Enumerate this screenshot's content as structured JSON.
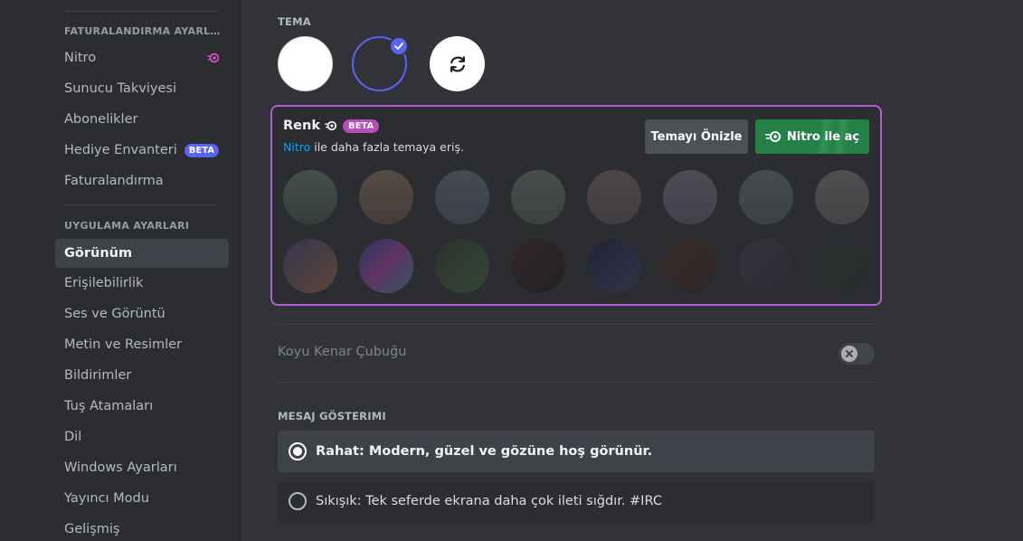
{
  "sidebar": {
    "billing_header": "FATURALANDIRMA AYARLA...",
    "billing_items": [
      {
        "label": "Nitro"
      },
      {
        "label": "Sunucu Takviyesi"
      },
      {
        "label": "Abonelikler"
      },
      {
        "label": "Hediye Envanteri",
        "badge": "BETA"
      },
      {
        "label": "Faturalandırma"
      }
    ],
    "app_header": "UYGULAMA AYARLARI",
    "app_items": [
      {
        "label": "Görünüm",
        "active": true
      },
      {
        "label": "Erişilebilirlik"
      },
      {
        "label": "Ses ve Görüntü"
      },
      {
        "label": "Metin ve Resimler"
      },
      {
        "label": "Bildirimler"
      },
      {
        "label": "Tuş Atamaları"
      },
      {
        "label": "Dil"
      },
      {
        "label": "Windows Ayarları"
      },
      {
        "label": "Yayıncı Modu"
      },
      {
        "label": "Gelişmiş"
      }
    ]
  },
  "theme": {
    "label": "TEMA",
    "selected": "dark",
    "color": {
      "title": "Renk",
      "badge": "BETA",
      "subtitle_link": "Nitro",
      "subtitle_rest": " ile daha fazla temaya eriş.",
      "preview_button": "Temayı Önizle",
      "nitro_button": "Nitro ile aç"
    }
  },
  "dark_sidebar": {
    "label": "Koyu Kenar Çubuğu",
    "enabled": false
  },
  "message_display": {
    "label": "MESAJ GÖSTERIMI",
    "options": [
      {
        "label": "Rahat: Modern, güzel ve gözüne hoş görünür.",
        "selected": true
      },
      {
        "label": "Sıkışık: Tek seferde ekrana daha çok ileti sığdır. #IRC",
        "selected": false
      }
    ]
  },
  "colors": {
    "accent": "#5865f2",
    "nitro_green": "#248046",
    "beta_pink": "#b94dba",
    "link": "#00a8fc"
  }
}
